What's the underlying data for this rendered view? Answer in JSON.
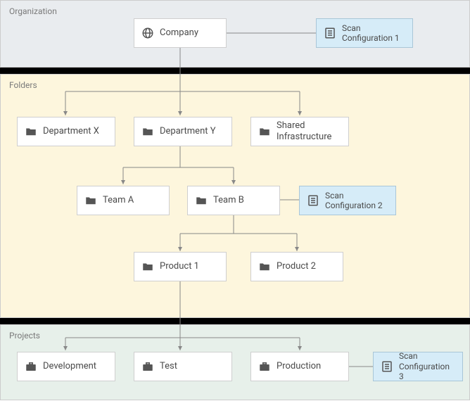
{
  "bands": {
    "organization": "Organization",
    "folders": "Folders",
    "projects": "Projects"
  },
  "nodes": {
    "company": "Company",
    "scan1": "Scan Configuration 1",
    "deptX": "Department X",
    "deptY": "Department Y",
    "shared": "Shared Infrastructure",
    "teamA": "Team A",
    "teamB": "Team B",
    "scan2": "Scan Configuration 2",
    "product1": "Product 1",
    "product2": "Product 2",
    "development": "Development",
    "test": "Test",
    "production": "Production",
    "scan3": "Scan Configuration 3"
  }
}
